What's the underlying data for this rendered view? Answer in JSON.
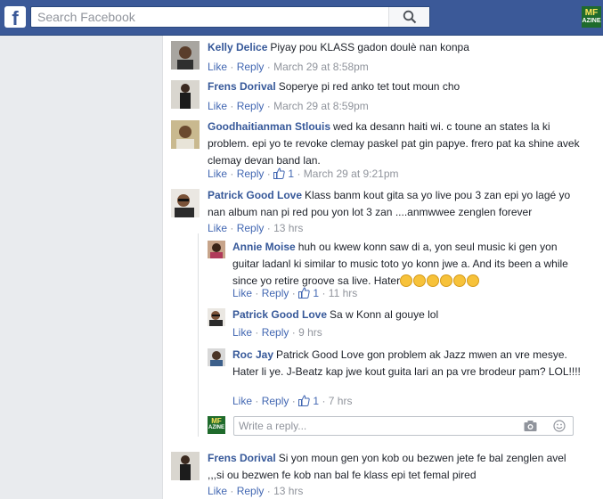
{
  "topbar": {
    "logo_letter": "f",
    "search_placeholder": "Search Facebook",
    "brand_line1": "MF",
    "brand_line2": "AZINE"
  },
  "comments": [
    {
      "author": "Kelly Delice",
      "text": "Piyay pou KLASS gadon doulè nan konpa",
      "like": "Like",
      "reply": "Reply",
      "likes": "",
      "time": "March 29 at 8:58pm"
    },
    {
      "author": "Frens Dorival",
      "text": "Soperye pi red anko tet tout moun cho",
      "like": "Like",
      "reply": "Reply",
      "likes": "",
      "time": "March 29 at 8:59pm"
    },
    {
      "author": "Goodhaitianman Stlouis",
      "text": "wed ka desann haiti wi. c toune an states la ki problem. epi yo te revoke clemay paskel pat gin papye. frero pat ka shine avek clemay devan band lan.",
      "like": "Like",
      "reply": "Reply",
      "likes": "1",
      "time": "March 29 at 9:21pm"
    },
    {
      "author": "Patrick Good Love",
      "text": "Klass banm kout gita sa yo live pou 3 zan epi yo lagé yo nan album nan pi red pou yon lot 3 zan ....anmwwee zenglen forever",
      "like": "Like",
      "reply": "Reply",
      "likes": "",
      "time": "13 hrs"
    },
    {
      "author": "Frens Dorival",
      "text": "Si yon moun gen yon kob ou bezwen jete fe bal zenglen avel ,,,si ou bezwen fe kob nan bal fe klass epi tet femal pired",
      "like": "Like",
      "reply": "Reply",
      "likes": "",
      "time": "13 hrs"
    }
  ],
  "replies": [
    {
      "author": "Annie Moise",
      "text": "huh ou kwew konn saw di a, yon seul music ki gen yon guitar ladanl ki similar to music toto yo konn jwe a. And its been a while since yo retire groove sa live. Hater",
      "like": "Like",
      "reply": "Reply",
      "likes": "1",
      "time": "11 hrs"
    },
    {
      "author": "Patrick Good Love",
      "text": "Sa w Konn al gouye lol",
      "like": "Like",
      "reply": "Reply",
      "likes": "",
      "time": "9 hrs"
    },
    {
      "author": "Roc Jay",
      "text": "Patrick Good Love gon problem ak Jazz mwen an vre mesye. Hater li ye. J-Beatz kap jwe kout guita lari an pa vre brodeur pam? LOL!!!!",
      "like": "Like",
      "reply": "Reply",
      "likes": "1",
      "time": "7 hrs"
    }
  ],
  "reply_box": {
    "placeholder": "Write a reply..."
  },
  "sep": "·",
  "colors": {
    "topbar": "#3b5998",
    "link": "#365899",
    "meta": "#90949c"
  }
}
